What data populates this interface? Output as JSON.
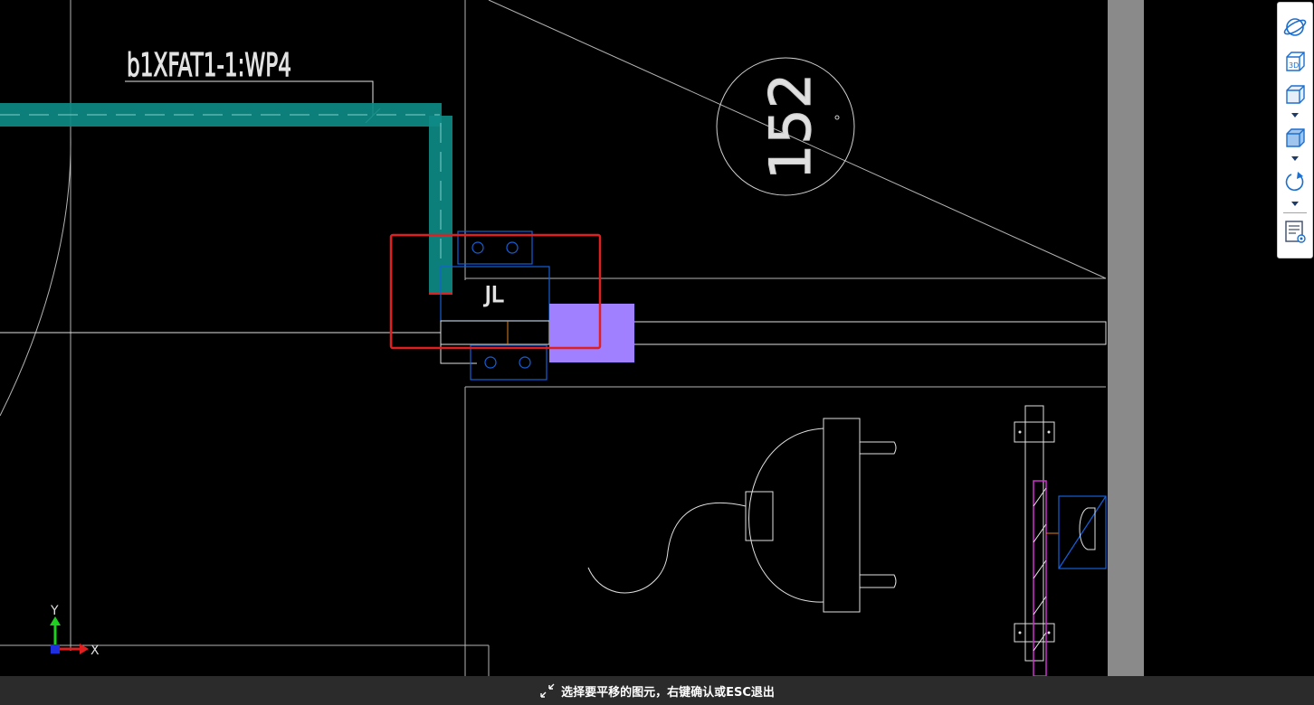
{
  "drawing": {
    "pipe_tag_label": "b1XFAT1-1:WP4",
    "equipment_label": "JL",
    "room_number": "152",
    "axis_y_label": "Y",
    "axis_x_label": "X"
  },
  "colors": {
    "background": "#000000",
    "pipe_teal": "#0e8a86",
    "highlight_red": "#e02020",
    "selected_fill_purple": "#a080ff",
    "blue_outline": "#1560d8",
    "magenta_pipe": "#d030d0",
    "wall_gray": "#8a8a8a",
    "toolbar_icon_blue": "#1d6fcf"
  },
  "view_toolbar": {
    "buttons": [
      {
        "name": "orbit",
        "icon": "orbit-icon"
      },
      {
        "name": "3d-view",
        "icon": "3d-view-icon",
        "label": "3D"
      },
      {
        "name": "view-cube-front",
        "icon": "view-cube-icon"
      },
      {
        "name": "view-cube-shaded",
        "icon": "shaded-cube-icon"
      },
      {
        "name": "rotate",
        "icon": "rotate-icon"
      },
      {
        "name": "display-settings",
        "icon": "display-settings-icon"
      }
    ]
  },
  "status_bar": {
    "prompt": "选择要平移的图元，右键确认或ESC退出"
  }
}
